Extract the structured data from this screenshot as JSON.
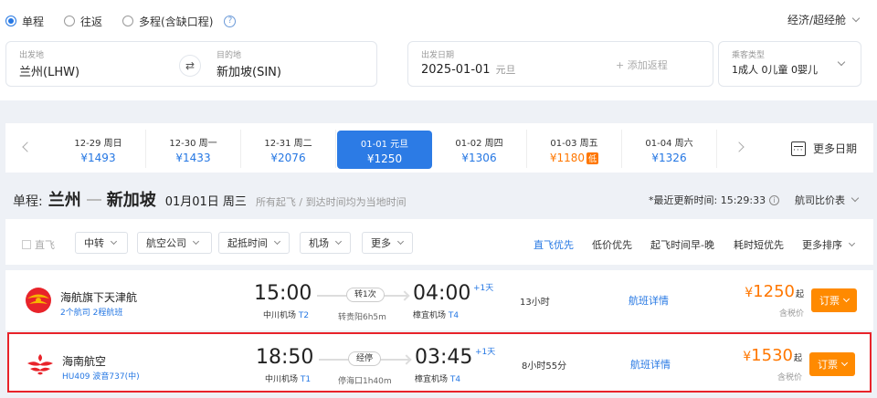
{
  "trip_types": [
    {
      "label": "单程",
      "selected": true
    },
    {
      "label": "往返",
      "selected": false
    },
    {
      "label": "多程(含缺口程)",
      "selected": false
    }
  ],
  "cabin": "经济/超经舱",
  "search": {
    "from_label": "出发地",
    "from_value": "兰州(LHW)",
    "to_label": "目的地",
    "to_value": "新加坡(SIN)",
    "date_label": "出发日期",
    "date_value": "2025-01-01",
    "date_holiday": "元旦",
    "add_return": "+ 添加返程",
    "pax_label": "乘客类型",
    "pax_value": "1成人  0儿童  0婴儿"
  },
  "date_strip": [
    {
      "date": "12-29 周日",
      "price": "¥1493",
      "active": false,
      "low": false
    },
    {
      "date": "12-30 周一",
      "price": "¥1433",
      "active": false,
      "low": false
    },
    {
      "date": "12-31 周二",
      "price": "¥2076",
      "active": false,
      "low": false
    },
    {
      "date": "01-01 元旦",
      "price": "¥1250",
      "active": true,
      "low": false
    },
    {
      "date": "01-02 周四",
      "price": "¥1306",
      "active": false,
      "low": false
    },
    {
      "date": "01-03 周五",
      "price": "¥1180",
      "active": false,
      "low": true,
      "tag": "低"
    },
    {
      "date": "01-04 周六",
      "price": "¥1326",
      "active": false,
      "low": false
    }
  ],
  "more_dates": "更多日期",
  "route": {
    "prefix": "单程:",
    "from": "兰州",
    "to": "新加坡",
    "date": "01月01日 周三",
    "note": "所有起飞 / 到达时间均为当地时间",
    "updated": "*最近更新时间: 15:29:33",
    "compare": "航司比价表"
  },
  "filters": {
    "direct": "直飞",
    "buttons": [
      "中转",
      "航空公司",
      "起抵时间",
      "机场",
      "更多"
    ],
    "sorts": [
      "直飞优先",
      "低价优先",
      "起飞时间早-晚",
      "耗时短优先",
      "更多排序"
    ]
  },
  "flights": [
    {
      "airline": "海航旗下天津航",
      "sub": "2个航司  2程航班",
      "dep_time": "15:00",
      "dep_airport": "中川机场",
      "dep_term": "T2",
      "stop_pill": "转1次",
      "via": "转贵阳6h5m",
      "arr_time": "04:00",
      "plus_day": "+1天",
      "arr_airport": "樟宜机场",
      "arr_term": "T4",
      "duration": "13小时",
      "detail": "航班详情",
      "price": "1250",
      "currency": "¥",
      "qi": "起",
      "tax": "含税价",
      "book": "订票"
    },
    {
      "airline": "海南航空",
      "sub": "HU409 波音737(中)",
      "dep_time": "18:50",
      "dep_airport": "中川机场",
      "dep_term": "T1",
      "stop_pill": "经停",
      "via": "停海口1h40m",
      "arr_time": "03:45",
      "plus_day": "+1天",
      "arr_airport": "樟宜机场",
      "arr_term": "T4",
      "duration": "8小时55分",
      "detail": "航班详情",
      "price": "1530",
      "currency": "¥",
      "qi": "起",
      "tax": "含税价",
      "book": "订票"
    }
  ],
  "colors": {
    "accent": "#2c7be5",
    "price": "#ff7700",
    "book_button": "#ff8a00",
    "highlight_border": "#e8232a"
  }
}
